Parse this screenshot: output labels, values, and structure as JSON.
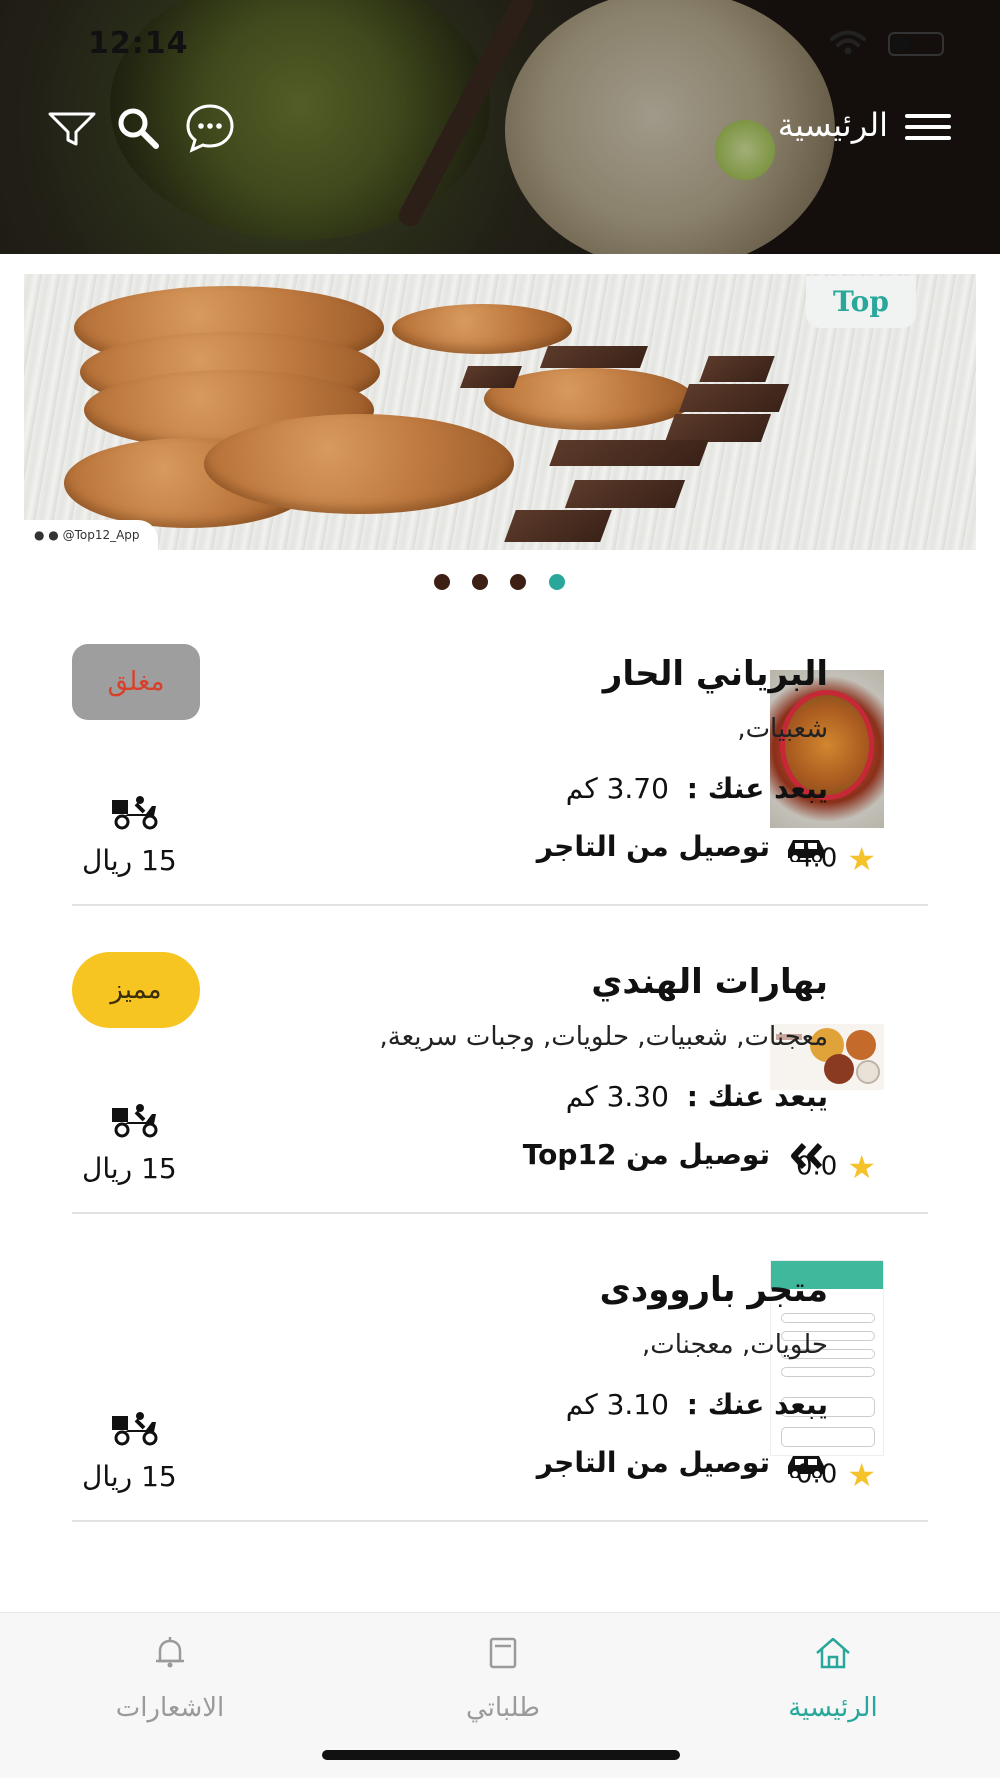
{
  "status_bar": {
    "time": "12:14"
  },
  "header": {
    "title": "الرئيسية"
  },
  "banner": {
    "logo_text": "Top",
    "handle": "@Top12_App"
  },
  "carousel": {
    "count": 4,
    "active_index": 3
  },
  "stores": [
    {
      "name": "البرياني الحار",
      "categories": "شعبيات,",
      "distance_label": "يبعد عنك :",
      "distance_value": "3.70 كم",
      "delivery": "توصيل من التاجر",
      "delivery_icon": "car-icon",
      "rating": "4.0",
      "status": "مغلق",
      "status_type": "closed",
      "fee": "15 ريال"
    },
    {
      "name": "بهارات الهندي",
      "categories": "معجنات, شعبيات, حلويات, وجبات سريعة,",
      "distance_label": "يبعد عنك :",
      "distance_value": "3.30 كم",
      "delivery": "توصيل من Top12",
      "delivery_icon": "double-chevron-icon",
      "rating": "0.0",
      "status": "مميز",
      "status_type": "featured",
      "fee": "15 ريال"
    },
    {
      "name": "متجر باروودى",
      "categories": "حلويات, معجنات,",
      "distance_label": "يبعد عنك :",
      "distance_value": "3.10 كم",
      "delivery": "توصيل من التاجر",
      "delivery_icon": "car-icon",
      "rating": "0.0",
      "status": "",
      "status_type": "none",
      "fee": "15 ريال"
    }
  ],
  "bottom_nav": {
    "home": "الرئيسية",
    "orders": "طلباتي",
    "notifications": "الاشعارات",
    "active": "home"
  },
  "colors": {
    "accent": "#2aa79b",
    "featured": "#f7c521",
    "closed_bg": "#9e9e9e",
    "closed_text": "#d9402b",
    "star": "#f4c22b"
  }
}
